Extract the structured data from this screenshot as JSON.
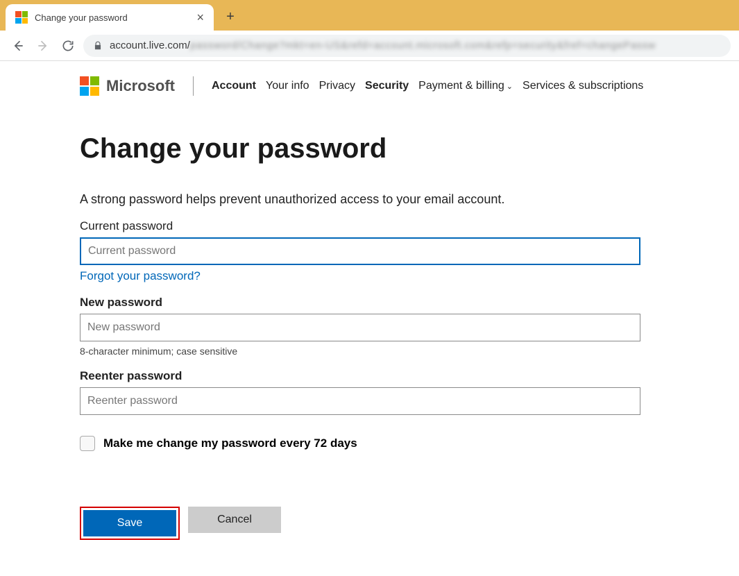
{
  "browser": {
    "tab_title": "Change your password",
    "url_visible": "account.live.com/",
    "url_blurred": "password/Change?mkt=en-US&refd=account.microsoft.com&refp=security&fref=changePassw"
  },
  "header": {
    "brand": "Microsoft",
    "nav": {
      "account": "Account",
      "your_info": "Your info",
      "privacy": "Privacy",
      "security": "Security",
      "payment": "Payment & billing",
      "services": "Services & subscriptions"
    }
  },
  "page": {
    "title": "Change your password",
    "subtitle": "A strong password helps prevent unauthorized access to your email account.",
    "current_label": "Current password",
    "current_placeholder": "Current password",
    "forgot_link": "Forgot your password?",
    "new_label": "New password",
    "new_placeholder": "New password",
    "hint": "8-character minimum; case sensitive",
    "reenter_label": "Reenter password",
    "reenter_placeholder": "Reenter password",
    "checkbox_label": "Make me change my password every 72 days",
    "save_btn": "Save",
    "cancel_btn": "Cancel"
  }
}
